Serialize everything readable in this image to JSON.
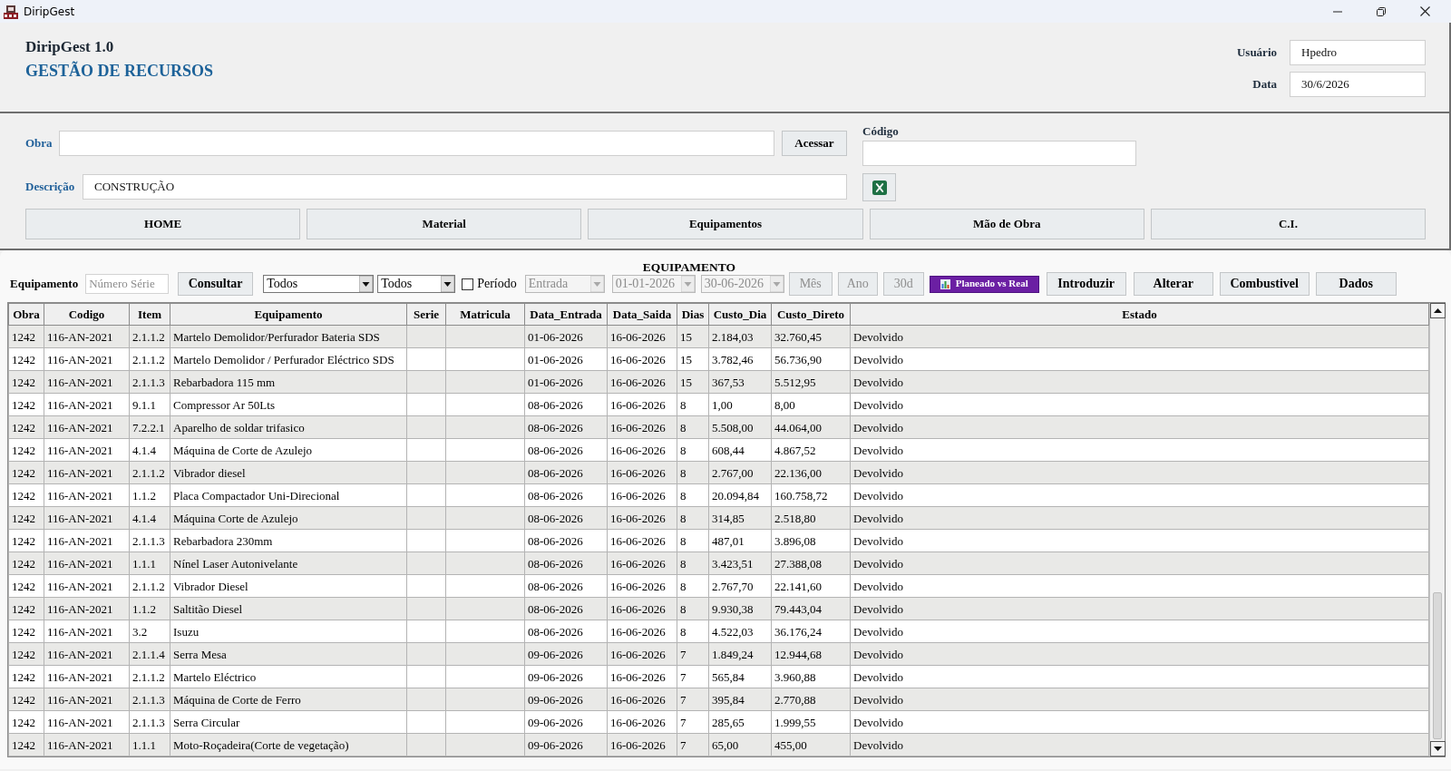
{
  "window": {
    "title": "DiripGest"
  },
  "header": {
    "app_name": "DiripGest 1.0",
    "subtitle": "GESTÃO DE RECURSOS",
    "fields": [
      {
        "label": "Usuário",
        "value": "Hpedro"
      },
      {
        "label": "Data",
        "value": "30/6/2026"
      }
    ]
  },
  "project_form": {
    "obra": {
      "label": "Obra"
    },
    "access_button": "Acessar",
    "codigo": {
      "label": "Código"
    },
    "descricao": {
      "label": "Descrição",
      "value": "CONSTRUÇÃO"
    }
  },
  "nav_buttons": [
    {
      "label": "HOME"
    },
    {
      "label": "Material"
    },
    {
      "label": "Equipamentos"
    },
    {
      "label": "Mão de Obra"
    },
    {
      "label": "C.I."
    }
  ],
  "equipment": {
    "title": "EQUIPAMENTO",
    "search": {
      "label": "Equipamento",
      "placeholder": "Número Série"
    },
    "search_button": "Consultar",
    "dropdowns": [
      {
        "value": "Todos",
        "disabled": false
      },
      {
        "value": "Todos",
        "disabled": false
      }
    ],
    "period": {
      "label": "Período",
      "checked": false
    },
    "period_dropdowns": [
      {
        "value": "Entrada",
        "disabled": true
      },
      {
        "value": "01-01-2026",
        "disabled": true
      },
      {
        "value": "30-06-2026",
        "disabled": true
      }
    ],
    "range_buttons": [
      {
        "label": "Mês",
        "disabled": true
      },
      {
        "label": "Ano",
        "disabled": true
      },
      {
        "label": "30d",
        "disabled": true
      }
    ],
    "chart_button": "Planeado vs Real",
    "action_buttons": [
      "Introduzir",
      "Alterar",
      "Combustivel",
      "Dados"
    ],
    "table": {
      "columns": [
        "Obra",
        "Codigo",
        "Item",
        "Equipamento",
        "Serie",
        "Matricula",
        "Data_Entrada",
        "Data_Saida",
        "Dias",
        "Custo_Dia",
        "Custo_Direto",
        "Estado"
      ],
      "rows": [
        {
          "obra": "1242",
          "codigo": "116-AN-2021",
          "item": "2.1.1.2",
          "equipamento": "Martelo Demolidor/Perfurador Bateria SDS",
          "data_entrada": "01-06-2026",
          "data_saida": "16-06-2026",
          "dias": "15",
          "custo_dia": "2.184,03",
          "custo_direto": "32.760,45",
          "estado": "Devolvido"
        },
        {
          "obra": "1242",
          "codigo": "116-AN-2021",
          "item": "2.1.1.2",
          "equipamento": "Martelo Demolidor / Perfurador Eléctrico SDS",
          "data_entrada": "01-06-2026",
          "data_saida": "16-06-2026",
          "dias": "15",
          "custo_dia": "3.782,46",
          "custo_direto": "56.736,90",
          "estado": "Devolvido"
        },
        {
          "obra": "1242",
          "codigo": "116-AN-2021",
          "item": "2.1.1.3",
          "equipamento": "Rebarbadora 115 mm",
          "data_entrada": "01-06-2026",
          "data_saida": "16-06-2026",
          "dias": "15",
          "custo_dia": "367,53",
          "custo_direto": "5.512,95",
          "estado": "Devolvido"
        },
        {
          "obra": "1242",
          "codigo": "116-AN-2021",
          "item": "9.1.1",
          "equipamento": "Compressor Ar 50Lts",
          "data_entrada": "08-06-2026",
          "data_saida": "16-06-2026",
          "dias": "8",
          "custo_dia": "1,00",
          "custo_direto": "8,00",
          "estado": "Devolvido"
        },
        {
          "obra": "1242",
          "codigo": "116-AN-2021",
          "item": "7.2.2.1",
          "equipamento": "Aparelho de soldar trifasico",
          "data_entrada": "08-06-2026",
          "data_saida": "16-06-2026",
          "dias": "8",
          "custo_dia": "5.508,00",
          "custo_direto": "44.064,00",
          "estado": "Devolvido"
        },
        {
          "obra": "1242",
          "codigo": "116-AN-2021",
          "item": "4.1.4",
          "equipamento": "Máquina de Corte de Azulejo",
          "data_entrada": "08-06-2026",
          "data_saida": "16-06-2026",
          "dias": "8",
          "custo_dia": "608,44",
          "custo_direto": "4.867,52",
          "estado": "Devolvido"
        },
        {
          "obra": "1242",
          "codigo": "116-AN-2021",
          "item": "2.1.1.2",
          "equipamento": "Vibrador diesel",
          "data_entrada": "08-06-2026",
          "data_saida": "16-06-2026",
          "dias": "8",
          "custo_dia": "2.767,00",
          "custo_direto": "22.136,00",
          "estado": "Devolvido"
        },
        {
          "obra": "1242",
          "codigo": "116-AN-2021",
          "item": "1.1.2",
          "equipamento": "Placa Compactador Uni-Direcional",
          "data_entrada": "08-06-2026",
          "data_saida": "16-06-2026",
          "dias": "8",
          "custo_dia": "20.094,84",
          "custo_direto": "160.758,72",
          "estado": "Devolvido"
        },
        {
          "obra": "1242",
          "codigo": "116-AN-2021",
          "item": "4.1.4",
          "equipamento": "Máquina Corte de Azulejo",
          "data_entrada": "08-06-2026",
          "data_saida": "16-06-2026",
          "dias": "8",
          "custo_dia": "314,85",
          "custo_direto": "2.518,80",
          "estado": "Devolvido"
        },
        {
          "obra": "1242",
          "codigo": "116-AN-2021",
          "item": "2.1.1.3",
          "equipamento": "Rebarbadora 230mm",
          "data_entrada": "08-06-2026",
          "data_saida": "16-06-2026",
          "dias": "8",
          "custo_dia": "487,01",
          "custo_direto": "3.896,08",
          "estado": "Devolvido"
        },
        {
          "obra": "1242",
          "codigo": "116-AN-2021",
          "item": "1.1.1",
          "equipamento": "Nínel Laser Autonivelante",
          "data_entrada": "08-06-2026",
          "data_saida": "16-06-2026",
          "dias": "8",
          "custo_dia": "3.423,51",
          "custo_direto": "27.388,08",
          "estado": "Devolvido"
        },
        {
          "obra": "1242",
          "codigo": "116-AN-2021",
          "item": "2.1.1.2",
          "equipamento": "Vibrador Diesel",
          "data_entrada": "08-06-2026",
          "data_saida": "16-06-2026",
          "dias": "8",
          "custo_dia": "2.767,70",
          "custo_direto": "22.141,60",
          "estado": "Devolvido"
        },
        {
          "obra": "1242",
          "codigo": "116-AN-2021",
          "item": "1.1.2",
          "equipamento": "Saltitão Diesel",
          "data_entrada": "08-06-2026",
          "data_saida": "16-06-2026",
          "dias": "8",
          "custo_dia": "9.930,38",
          "custo_direto": "79.443,04",
          "estado": "Devolvido"
        },
        {
          "obra": "1242",
          "codigo": "116-AN-2021",
          "item": "3.2",
          "equipamento": "Isuzu",
          "data_entrada": "08-06-2026",
          "data_saida": "16-06-2026",
          "dias": "8",
          "custo_dia": "4.522,03",
          "custo_direto": "36.176,24",
          "estado": "Devolvido"
        },
        {
          "obra": "1242",
          "codigo": "116-AN-2021",
          "item": "2.1.1.4",
          "equipamento": "Serra Mesa",
          "data_entrada": "09-06-2026",
          "data_saida": "16-06-2026",
          "dias": "7",
          "custo_dia": "1.849,24",
          "custo_direto": "12.944,68",
          "estado": "Devolvido"
        },
        {
          "obra": "1242",
          "codigo": "116-AN-2021",
          "item": "2.1.1.2",
          "equipamento": "Martelo Eléctrico",
          "data_entrada": "09-06-2026",
          "data_saida": "16-06-2026",
          "dias": "7",
          "custo_dia": "565,84",
          "custo_direto": "3.960,88",
          "estado": "Devolvido"
        },
        {
          "obra": "1242",
          "codigo": "116-AN-2021",
          "item": "2.1.1.3",
          "equipamento": "Máquina de Corte de Ferro",
          "data_entrada": "09-06-2026",
          "data_saida": "16-06-2026",
          "dias": "7",
          "custo_dia": "395,84",
          "custo_direto": "2.770,88",
          "estado": "Devolvido"
        },
        {
          "obra": "1242",
          "codigo": "116-AN-2021",
          "item": "2.1.1.3",
          "equipamento": "Serra Circular",
          "data_entrada": "09-06-2026",
          "data_saida": "16-06-2026",
          "dias": "7",
          "custo_dia": "285,65",
          "custo_direto": "1.999,55",
          "estado": "Devolvido"
        },
        {
          "obra": "1242",
          "codigo": "116-AN-2021",
          "item": "1.1.1",
          "equipamento": "Moto-Roçadeira(Corte de vegetação)",
          "data_entrada": "09-06-2026",
          "data_saida": "16-06-2026",
          "dias": "7",
          "custo_dia": "65,00",
          "custo_direto": "455,00",
          "estado": "Devolvido"
        }
      ]
    }
  }
}
